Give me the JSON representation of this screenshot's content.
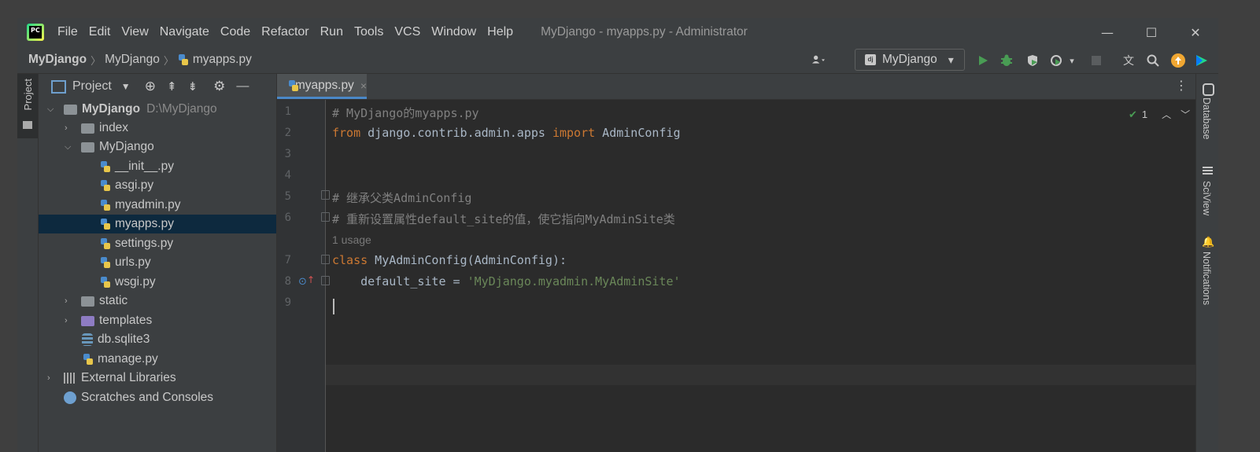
{
  "app": {
    "logo_text": "PC"
  },
  "menu": [
    "File",
    "Edit",
    "View",
    "Navigate",
    "Code",
    "Refactor",
    "Run",
    "Tools",
    "VCS",
    "Window",
    "Help"
  ],
  "window_title": "MyDjango - myapps.py - Administrator",
  "window_controls": {
    "minimize": "—",
    "maximize": "☐",
    "close": "✕"
  },
  "breadcrumb": {
    "project": "MyDjango",
    "folder": "MyDjango",
    "file": "myapps.py"
  },
  "run_config": {
    "badge": "dj",
    "name": "MyDjango",
    "caret": "▾"
  },
  "toolbar_icons": [
    "account-icon",
    "run-icon",
    "debug-icon",
    "coverage-icon",
    "profile-icon",
    "stop-icon",
    "translate-icon",
    "search-icon",
    "update-icon",
    "jetbrains-icon"
  ],
  "left_stripe": {
    "project_label": "Project"
  },
  "right_stripe": {
    "database": "Database",
    "sciview": "SciView",
    "notifications": "Notifications"
  },
  "project_panel": {
    "title": "Project",
    "tree": [
      {
        "label": "MyDjango",
        "path": "D:\\MyDjango",
        "type": "folder",
        "expanded": true
      },
      {
        "label": "index",
        "type": "folder",
        "expanded": false
      },
      {
        "label": "MyDjango",
        "type": "folder",
        "expanded": true
      },
      {
        "label": "__init__.py",
        "type": "py"
      },
      {
        "label": "asgi.py",
        "type": "py"
      },
      {
        "label": "myadmin.py",
        "type": "py"
      },
      {
        "label": "myapps.py",
        "type": "py",
        "selected": true
      },
      {
        "label": "settings.py",
        "type": "py"
      },
      {
        "label": "urls.py",
        "type": "py"
      },
      {
        "label": "wsgi.py",
        "type": "py"
      },
      {
        "label": "static",
        "type": "folder",
        "expanded": false
      },
      {
        "label": "templates",
        "type": "folder",
        "expanded": false
      },
      {
        "label": "db.sqlite3",
        "type": "db"
      },
      {
        "label": "manage.py",
        "type": "py"
      },
      {
        "label": "External Libraries",
        "type": "lib",
        "expanded": false
      },
      {
        "label": "Scratches and Consoles",
        "type": "scratch"
      }
    ]
  },
  "editor": {
    "tab": {
      "label": "myapps.py",
      "close": "×"
    },
    "inspection": {
      "count": "1"
    },
    "lines": [
      {
        "num": "1",
        "text": "# MyDjango的myapps.py"
      },
      {
        "num": "2",
        "text": "from django.contrib.admin.apps import AdminConfig"
      },
      {
        "num": "3",
        "text": ""
      },
      {
        "num": "4",
        "text": ""
      },
      {
        "num": "5",
        "text": "# 继承父类AdminConfig"
      },
      {
        "num": "6",
        "text": "# 重新设置属性default_site的值，使它指向MyAdminSite类"
      },
      {
        "num": "7",
        "text": "class MyAdminConfig(AdminConfig):"
      },
      {
        "num": "8",
        "text": "    default_site = 'MyDjango.myadmin.MyAdminSite'"
      },
      {
        "num": "9",
        "text": ""
      }
    ],
    "usage_hint": "1 usage",
    "tokens": {
      "l1": "# MyDjango的myapps.py",
      "l2_kw1": "from",
      "l2_mod": " django.contrib.admin.apps ",
      "l2_kw2": "import",
      "l2_name": " AdminConfig",
      "l5": "# 继承父类AdminConfig",
      "l6": "# 重新设置属性default_site的值，使它指向MyAdminSite类",
      "l7_kw": "class",
      "l7_rest": " MyAdminConfig(AdminConfig):",
      "l8_name": "    default_site = ",
      "l8_str": "'MyDjango.myadmin.MyAdminSite'"
    }
  },
  "colors": {
    "keyword": "#cc7832",
    "string": "#6a8759",
    "comment": "#808080",
    "selection": "#0d293e",
    "accent": "#4a88c7"
  }
}
